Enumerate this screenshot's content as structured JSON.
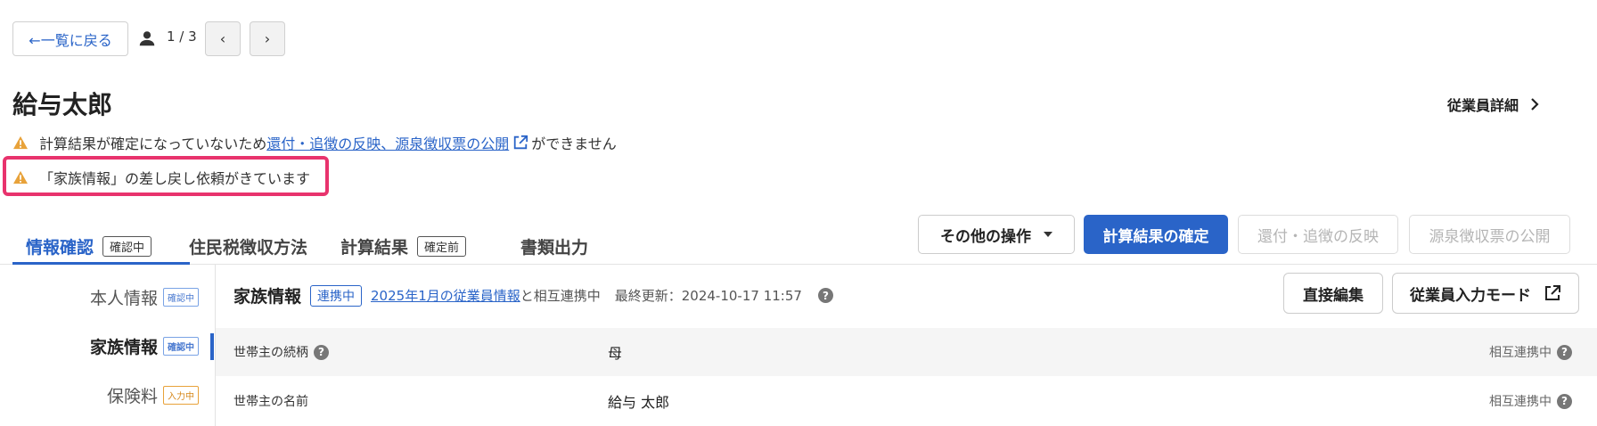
{
  "header": {
    "back_label": "←一覧に戻る",
    "pager_count": "1 / 3",
    "prev_label": "‹",
    "next_label": "›"
  },
  "employee": {
    "name": "給与太郎",
    "detail_label": "従業員詳細"
  },
  "warnings": {
    "w1_prefix": "計算結果が確定になっていないため",
    "w1_link": "還付・追徴の反映、源泉徴収票の公開",
    "w1_suffix": "ができません",
    "w2": "「家族情報」の差し戻し依頼がきています"
  },
  "tabs": [
    {
      "label": "情報確認",
      "badge": "確認中"
    },
    {
      "label": "住民税徴収方法",
      "badge": ""
    },
    {
      "label": "計算結果",
      "badge": "確定前"
    },
    {
      "label": "書類出力",
      "badge": ""
    }
  ],
  "actions": {
    "other": "その他の操作",
    "confirm": "計算結果の確定",
    "refund": "還付・追徴の反映",
    "publish": "源泉徴収票の公開"
  },
  "sidebar": {
    "items": [
      {
        "label": "本人情報",
        "badge": "確認中"
      },
      {
        "label": "家族情報",
        "badge": "確認中"
      },
      {
        "label": "保険料",
        "badge": "入力中"
      }
    ]
  },
  "section": {
    "title": "家族情報",
    "status": "連携中",
    "link": "2025年1月の従業員情報",
    "link_suffix": "と相互連携中",
    "updated": "最終更新：2024-10-17 11:57",
    "edit_button": "直接編集",
    "input_mode_button": "従業員入力モード"
  },
  "rows": [
    {
      "label": "世帯主の続柄",
      "value": "母",
      "sync": "相互連携中"
    },
    {
      "label": "世帯主の名前",
      "value": "給与 太郎",
      "sync": "相互連携中"
    }
  ],
  "colors": {
    "accent": "#2a64c8",
    "highlight": "#e8336d",
    "warning": "#e8a23a"
  }
}
